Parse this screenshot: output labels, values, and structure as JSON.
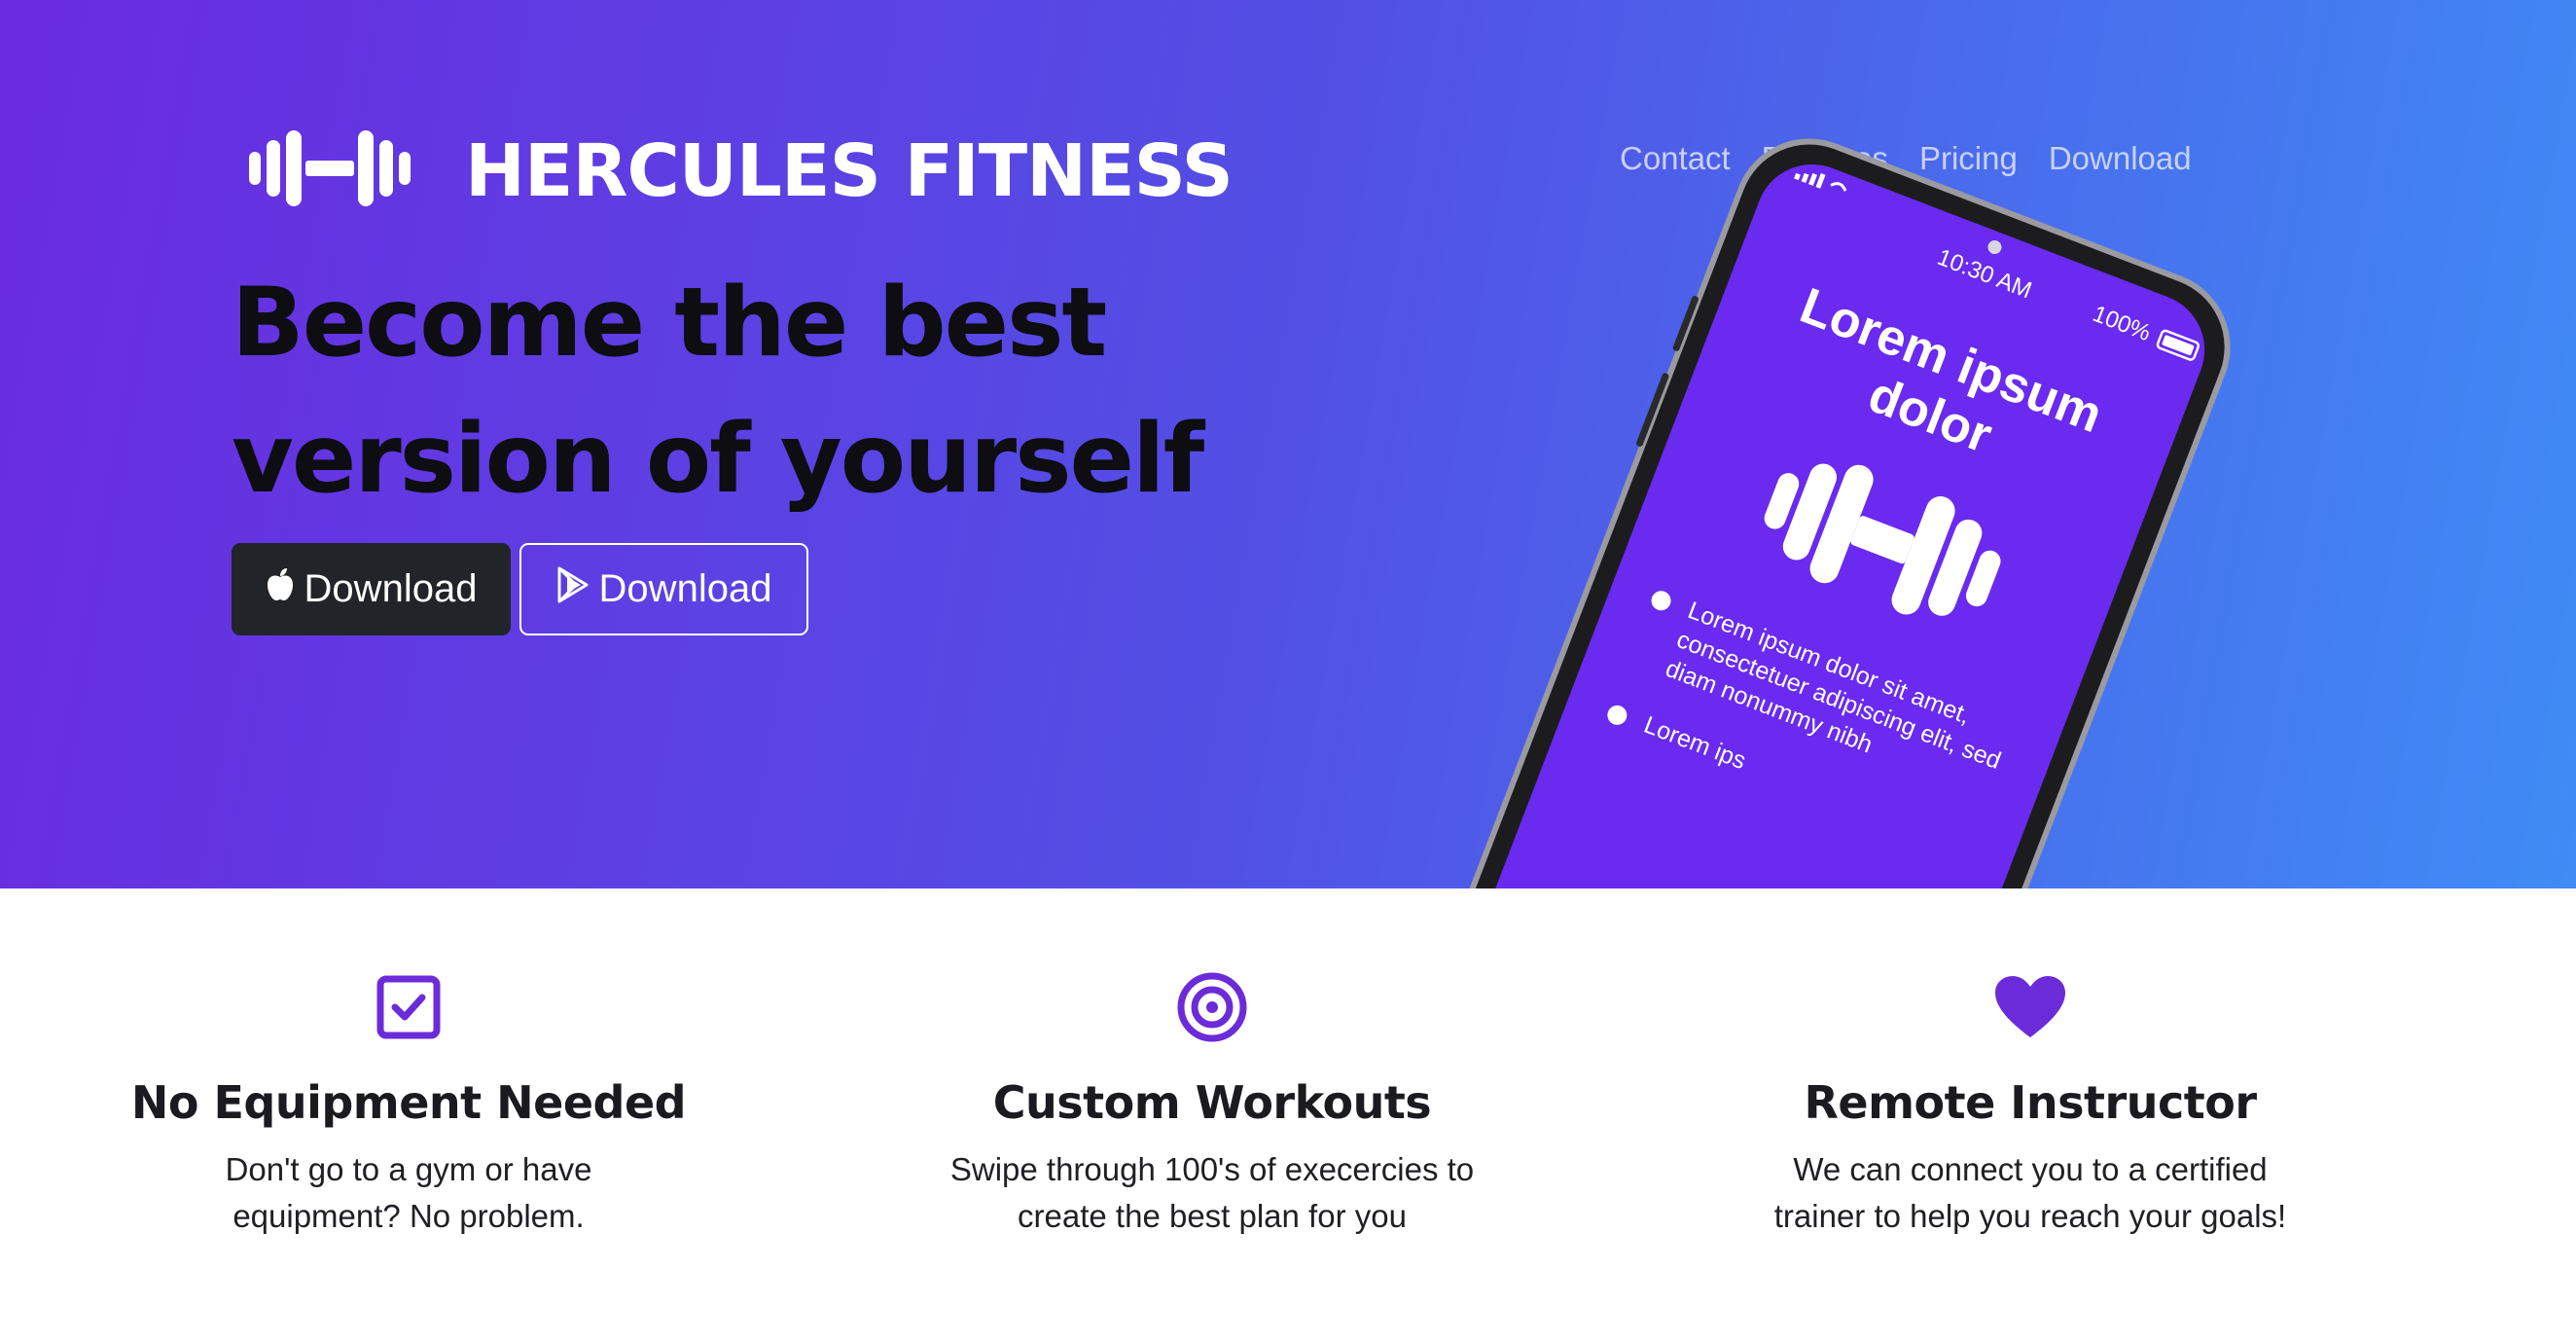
{
  "brand": {
    "name": "HERCULES FITNESS",
    "logo_icon": "dumbbell-icon"
  },
  "nav": {
    "items": [
      "Contact",
      "Features",
      "Pricing",
      "Download"
    ]
  },
  "hero": {
    "headline_line1": "Become the best",
    "headline_line2": "version of yourself",
    "buttons": [
      {
        "label": "Download",
        "icon": "apple-icon"
      },
      {
        "label": "Download",
        "icon": "google-play-icon"
      }
    ]
  },
  "phone": {
    "time": "10:30 AM",
    "battery": "100%",
    "title_line1": "Lorem ipsum",
    "title_line2": "dolor",
    "bullet1_lines": [
      "Lorem ipsum dolor sit amet,",
      "consectetuer adipiscing elit, sed",
      "diam nonummy nibh"
    ],
    "bullet2_partial": "Lorem ips"
  },
  "features": [
    {
      "icon": "checkbox-icon",
      "title": "No Equipment Needed",
      "line1": "Don't go to a gym or have",
      "line2": "equipment? No problem."
    },
    {
      "icon": "target-icon",
      "title": "Custom Workouts",
      "line1": "Swipe through 100's of execercies to",
      "line2": "create the best plan for you"
    },
    {
      "icon": "heart-icon",
      "title": "Remote Instructor",
      "line1": "We can connect you to a certified",
      "line2": "trainer to help you reach your goals!"
    }
  ],
  "colors": {
    "accent": "#6c2bd9",
    "hero_start": "#6a2be0",
    "hero_end": "#3f8cf5",
    "dark_button": "#212529"
  }
}
